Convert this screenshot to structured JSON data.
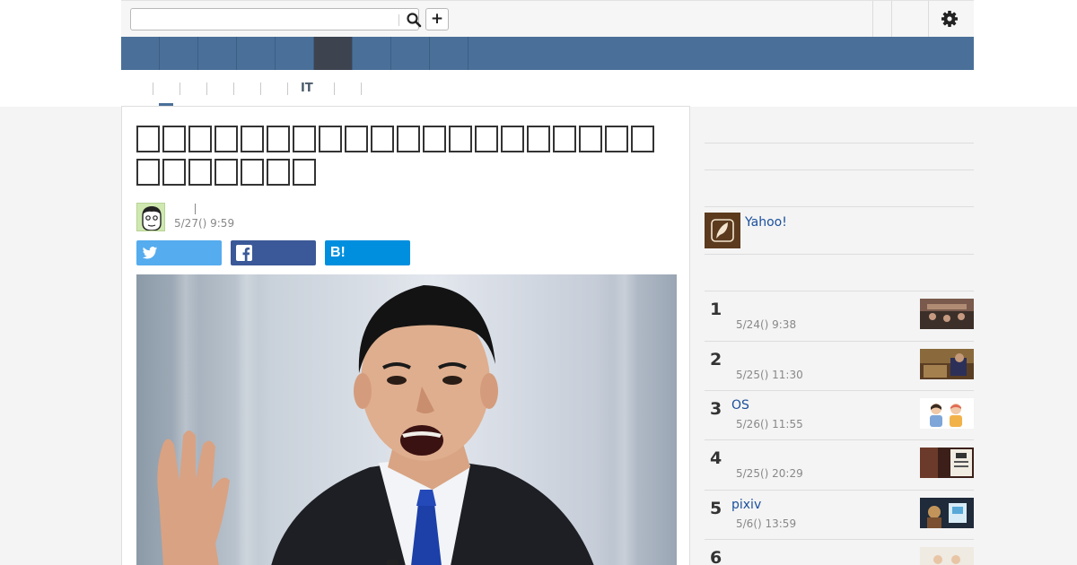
{
  "search": {
    "placeholder": "",
    "value": ""
  },
  "toolbar": {
    "add_label": "+"
  },
  "nav": {
    "items": [
      "",
      "",
      "",
      "",
      "",
      "",
      "",
      "",
      ""
    ],
    "active_index": 5
  },
  "subtabs": {
    "items": [
      "",
      "",
      "",
      "",
      "",
      "IT",
      "",
      ""
    ],
    "active_index": 0
  },
  "article": {
    "headline_box_count": 27,
    "post_date": "5/27() 9:59"
  },
  "share": {
    "twitter": "twitter-icon",
    "facebook": "facebook-icon",
    "hatena_label": "B!"
  },
  "sidebar": {
    "yahoo_label": "Yahoo!",
    "ranking": [
      {
        "rank": "1",
        "title": "",
        "date": "5/24() 9:38"
      },
      {
        "rank": "2",
        "title": "",
        "date": "5/25() 11:30"
      },
      {
        "rank": "3",
        "title": "OS",
        "date": "5/26() 11:55"
      },
      {
        "rank": "4",
        "title": "",
        "date": "5/25() 20:29"
      },
      {
        "rank": "5",
        "title": "pixiv",
        "date": "5/6() 13:59"
      },
      {
        "rank": "6",
        "title": "",
        "date": ""
      }
    ]
  },
  "colors": {
    "nav_blue": "#4a7099",
    "nav_active": "#3d4450",
    "link_blue": "#1a4f9c",
    "twitter": "#55acee",
    "facebook": "#3b5998",
    "hatena": "#008fde"
  }
}
